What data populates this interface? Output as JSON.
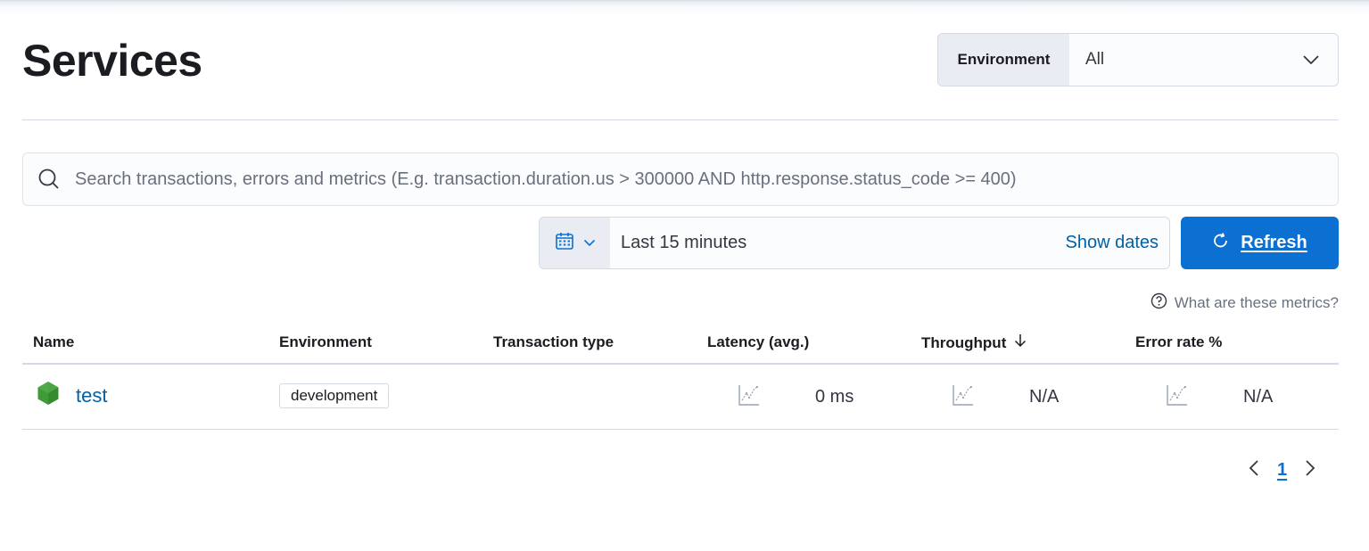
{
  "header": {
    "title": "Services"
  },
  "environment_filter": {
    "label": "Environment",
    "value": "All",
    "icon": "chevron-down-icon"
  },
  "search": {
    "placeholder": "Search transactions, errors and metrics (E.g. transaction.duration.us > 300000 AND http.response.status_code >= 400)",
    "value": "",
    "icon": "search-icon"
  },
  "date_picker": {
    "quick_menu_icon": "calendar-icon",
    "range_label": "Last 15 minutes",
    "show_dates_label": "Show dates"
  },
  "refresh_button": {
    "label": "Refresh",
    "icon": "refresh-icon"
  },
  "metrics_help": {
    "label": "What are these metrics?",
    "icon": "question-circle-icon"
  },
  "table": {
    "columns": [
      {
        "label": "Name"
      },
      {
        "label": "Environment"
      },
      {
        "label": "Transaction type"
      },
      {
        "label": "Latency (avg.)"
      },
      {
        "label": "Throughput",
        "sorted": "descending"
      },
      {
        "label": "Error rate %"
      }
    ],
    "rows": [
      {
        "name": "test",
        "agent_icon": "nodejs-icon",
        "environment": "development",
        "transaction_type": "",
        "latency": "0 ms",
        "throughput": "N/A",
        "error_rate": "N/A"
      }
    ]
  },
  "pagination": {
    "current_page": "1"
  },
  "colors": {
    "primary": "#0b70d1",
    "link": "#0061a6",
    "text": "#1a1c21",
    "border": "#d3dae6",
    "nodejs_green": "#3f9a39"
  }
}
